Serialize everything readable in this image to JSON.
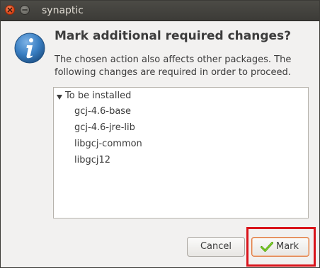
{
  "window": {
    "title": "synaptic"
  },
  "dialog": {
    "heading": "Mark additional required changes?",
    "description_lines": [
      "The chosen action also affects other packages. The",
      "following changes are required in order to proceed."
    ],
    "icon": "info-icon"
  },
  "changes": {
    "group_label": "To be installed",
    "packages": [
      "gcj-4.6-base",
      "gcj-4.6-jre-lib",
      "libgcj-common",
      "libgcj12"
    ]
  },
  "buttons": {
    "cancel_label": "Cancel",
    "mark_label": "Mark"
  },
  "colors": {
    "titlebar": "#3c3b37",
    "close_button": "#e0491c",
    "info_icon": "#3a7fc3",
    "highlight_box": "#d9141b",
    "mark_focus": "#e0793f"
  }
}
